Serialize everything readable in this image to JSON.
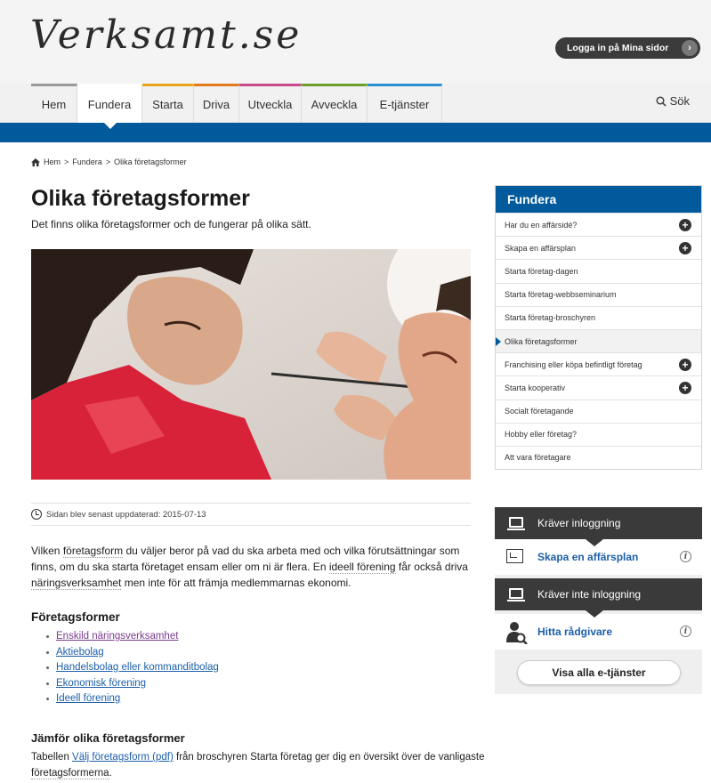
{
  "header": {
    "logo": "Verksamt.se",
    "login_label": "Logga in på Mina sidor",
    "login_arrow": "›"
  },
  "nav": {
    "items": [
      {
        "label": "Hem",
        "color": "#9a9a9a"
      },
      {
        "label": "Fundera",
        "color": "#ffffff",
        "active": true
      },
      {
        "label": "Starta",
        "color": "#e5a61d"
      },
      {
        "label": "Driva",
        "color": "#e27a1c"
      },
      {
        "label": "Utveckla",
        "color": "#c94a8c"
      },
      {
        "label": "Avveckla",
        "color": "#6d9f2e"
      },
      {
        "label": "E-tjänster",
        "color": "#2a8fd0"
      }
    ],
    "search_label": "Sök"
  },
  "breadcrumb": {
    "home": "Hem",
    "sep": ">",
    "level1": "Fundera",
    "current": "Olika företagsformer"
  },
  "main": {
    "title": "Olika företagsformer",
    "intro": "Det finns olika företagsformer och de fungerar på olika sätt.",
    "updated": "Sidan blev senast uppdaterad: 2015-07-13",
    "body": {
      "p1": "Vilken ",
      "l1": "företagsform",
      "p2": " du väljer beror på vad du ska arbeta med och vilka förutsättningar som finns, om du ska starta företaget ensam eller om ni är flera. En ",
      "l2": "ideell förening",
      "p3": " får också driva ",
      "l3": "näringsverksamhet",
      "p4": " men inte för att främja medlemmarnas ekonomi."
    },
    "forms_heading": "Företagsformer",
    "forms": [
      "Enskild näringsverksamhet",
      "Aktiebolag",
      "Handelsbolag eller kommanditbolag",
      "Ekonomisk förening",
      "Ideell förening"
    ],
    "compare_heading": "Jämför olika företagsformer",
    "compare": {
      "t1": "Tabellen ",
      "link": "Välj företagsform (pdf)",
      "t2": " från broschyren Starta företag ger dig en översikt över de vanligaste ",
      "l2": "företagsformerna",
      "t3": "."
    }
  },
  "sidebar": {
    "heading": "Fundera",
    "items": [
      {
        "label": "Har du en affärsidé?",
        "expand": true
      },
      {
        "label": "Skapa en affärsplan",
        "expand": true
      },
      {
        "label": "Starta företag-dagen"
      },
      {
        "label": "Starta företag-webbseminarium"
      },
      {
        "label": "Starta företag-broschyren"
      },
      {
        "label": "Olika företagsformer",
        "current": true
      },
      {
        "label": "Franchising eller köpa befintligt företag",
        "expand": true
      },
      {
        "label": "Starta kooperativ",
        "expand": true
      },
      {
        "label": "Socialt företagande"
      },
      {
        "label": "Hobby eller företag?"
      },
      {
        "label": "Att vara företagare"
      }
    ]
  },
  "eservices": {
    "login_required": "Kräver inloggning",
    "service1": "Skapa en affärsplan",
    "no_login": "Kräver inte inloggning",
    "service2": "Hitta rådgivare",
    "info": "i",
    "show_all": "Visa alla e-tjänster"
  },
  "colors": {
    "brand_blue": "#005a9c",
    "link_blue": "#1d5fa8",
    "dark": "#3a3a3a"
  }
}
